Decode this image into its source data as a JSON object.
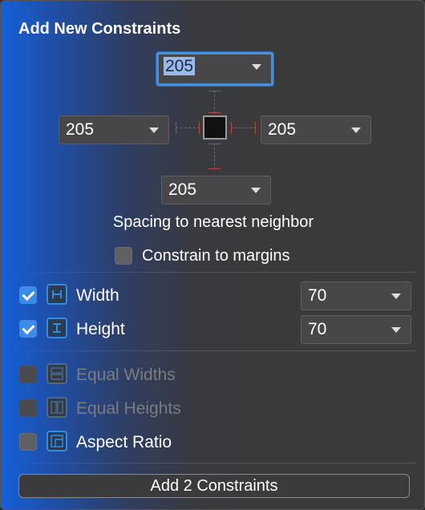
{
  "panel": {
    "title": "Add New Constraints"
  },
  "spacing": {
    "top": "205",
    "left": "205",
    "right": "205",
    "bottom": "205",
    "caption": "Spacing to nearest neighbor",
    "margins_label": "Constrain to margins",
    "margins_checked": false
  },
  "size": {
    "width": {
      "label": "Width",
      "checked": true,
      "value": "70",
      "icon": "width-icon"
    },
    "height": {
      "label": "Height",
      "checked": true,
      "value": "70",
      "icon": "height-icon"
    }
  },
  "options": {
    "equal_widths": {
      "label": "Equal Widths",
      "enabled": false,
      "icon": "equal-widths-icon"
    },
    "equal_heights": {
      "label": "Equal Heights",
      "enabled": false,
      "icon": "equal-heights-icon"
    },
    "aspect_ratio": {
      "label": "Aspect Ratio",
      "enabled": true,
      "checked": false,
      "icon": "aspect-ratio-icon"
    }
  },
  "action": {
    "label": "Add 2 Constraints"
  },
  "colors": {
    "accent": "#3b8ce8",
    "strut": "#bb4444"
  }
}
